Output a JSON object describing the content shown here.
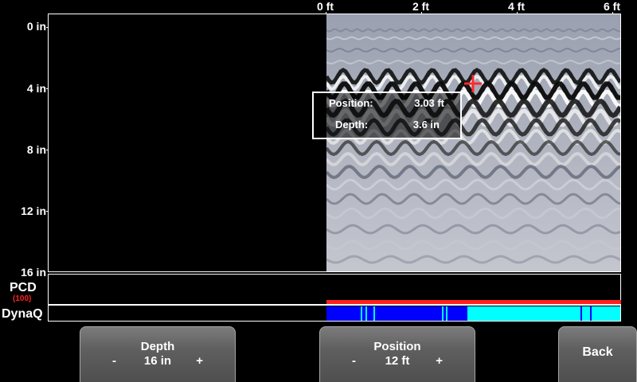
{
  "x_axis": {
    "ticks": [
      "0 ft",
      "2 ft",
      "4 ft",
      "6 ft"
    ]
  },
  "y_axis": {
    "ticks": [
      "0 in",
      "4 in",
      "8 in",
      "12 in",
      "16 in"
    ]
  },
  "readout": {
    "position_label": "Position:",
    "position_value": "3.03 ft",
    "depth_label": "Depth:",
    "depth_value": "3.6 in"
  },
  "pcd": {
    "label": "PCD",
    "value": "(100)"
  },
  "dynaq": {
    "label": "DynaQ"
  },
  "softkeys": {
    "depth": {
      "title": "Depth",
      "minus": "-",
      "value": "16 in",
      "plus": "+"
    },
    "position": {
      "title": "Position",
      "minus": "-",
      "value": "12 ft",
      "plus": "+"
    },
    "back": {
      "label": "Back"
    }
  },
  "colors": {
    "cursor": "#ff2a2a",
    "pcd_bar": "#ff2020",
    "dynaq_good": "#0000ff",
    "dynaq_marker": "#00ffff"
  }
}
